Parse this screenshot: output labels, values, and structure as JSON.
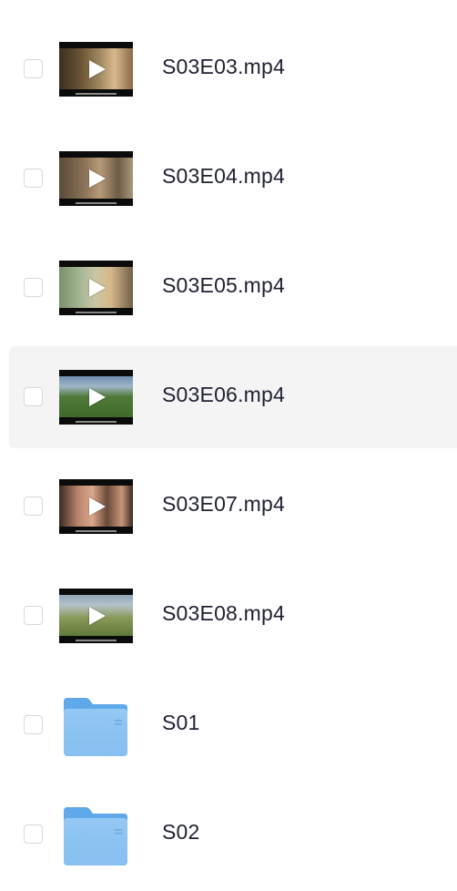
{
  "files": [
    {
      "name": "S03E03.mp4",
      "type": "video",
      "icon": "video-thumbnail-icon"
    },
    {
      "name": "S03E04.mp4",
      "type": "video",
      "icon": "video-thumbnail-icon"
    },
    {
      "name": "S03E05.mp4",
      "type": "video",
      "icon": "video-thumbnail-icon"
    },
    {
      "name": "S03E06.mp4",
      "type": "video",
      "icon": "video-thumbnail-icon",
      "hovered": true
    },
    {
      "name": "S03E07.mp4",
      "type": "video",
      "icon": "video-thumbnail-icon"
    },
    {
      "name": "S03E08.mp4",
      "type": "video",
      "icon": "video-thumbnail-icon"
    },
    {
      "name": "S01",
      "type": "folder",
      "icon": "folder-icon"
    },
    {
      "name": "S02",
      "type": "folder",
      "icon": "folder-icon"
    }
  ],
  "colors": {
    "text": "#1f2133",
    "hover_row": "#f4f4f4",
    "checkbox_border": "#d8d8d8",
    "folder_blue": "#8cc3f2"
  }
}
